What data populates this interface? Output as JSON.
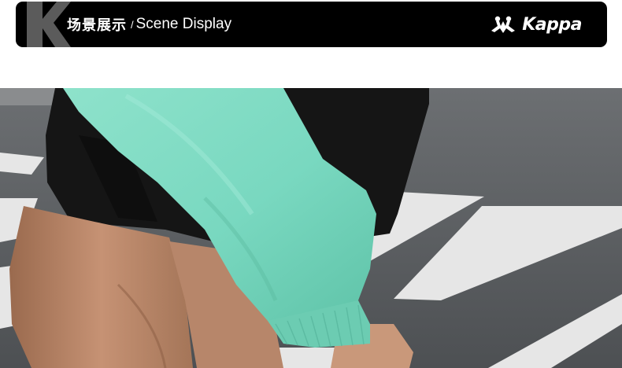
{
  "header": {
    "title_cn": "场景展示",
    "separator": "/",
    "title_en": "Scene Display",
    "brand_logo_text": "Kappa",
    "watermark_letter": "K",
    "logo_icon": "kappa-omini-icon"
  },
  "scene": {
    "description_icon": "product-scene-photo",
    "colors": {
      "sweatshirt": "#79d8c0",
      "shorts": "#141414",
      "asphalt": "#5a5d60",
      "crosswalk": "#e8e8e8",
      "skin": "#b98464"
    }
  },
  "colors": {
    "banner_bg": "#000000",
    "banner_text": "#ffffff",
    "watermark": "#5b5b5b"
  }
}
